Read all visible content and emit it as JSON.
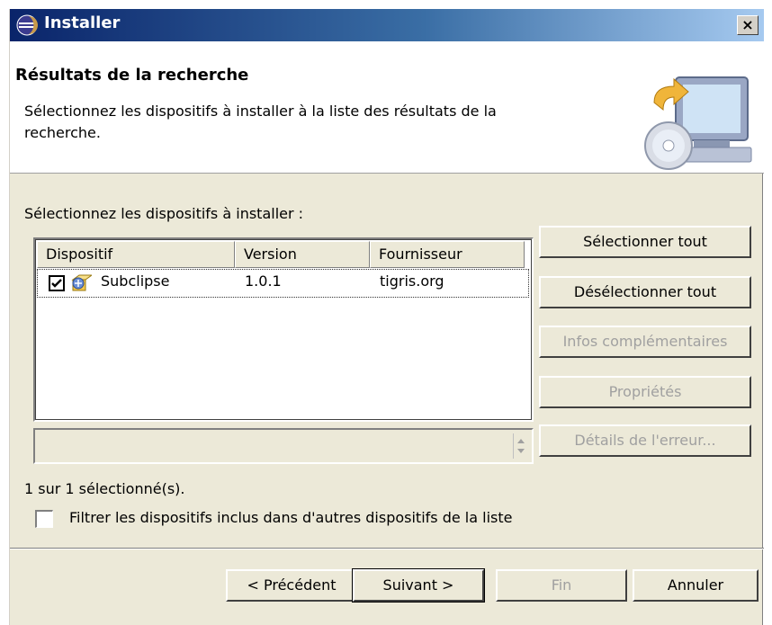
{
  "window": {
    "title": "Installer",
    "close_label": "×"
  },
  "header": {
    "heading": "Résultats de la recherche",
    "description": "Sélectionnez les dispositifs à installer à la liste des résultats de la recherche."
  },
  "section_label": "Sélectionnez les dispositifs à installer :",
  "table": {
    "columns": [
      "Dispositif",
      "Version",
      "Fournisseur"
    ],
    "rows": [
      {
        "checked": true,
        "feature": "Subclipse",
        "version": "1.0.1",
        "provider": "tigris.org"
      }
    ]
  },
  "side_buttons": {
    "select_all": "Sélectionner tout",
    "deselect_all": "Désélectionner tout",
    "more_info": "Infos complémentaires",
    "properties": "Propriétés",
    "error_details": "Détails de l'erreur..."
  },
  "status": "1 sur 1 sélectionné(s).",
  "filter": {
    "checked": false,
    "label": "Filtrer les dispositifs inclus dans d'autres dispositifs de la liste"
  },
  "footer": {
    "back": "< Précédent",
    "next": "Suivant >",
    "finish": "Fin",
    "cancel": "Annuler"
  },
  "colors": {
    "dialog_bg": "#ece9d8",
    "title_gradient_start": "#0a246a",
    "title_gradient_end": "#a6caf0",
    "disabled_text": "#a0a0a0"
  },
  "icons": [
    "eclipse-icon",
    "close-icon",
    "install-banner-icon",
    "checkbox-checked-icon",
    "feature-package-icon",
    "spinner-icon"
  ]
}
